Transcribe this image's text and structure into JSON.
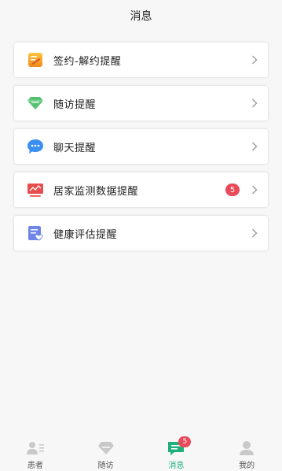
{
  "header": {
    "title": "消息"
  },
  "items": [
    {
      "label": "签约-解约提醒",
      "icon": "contract-icon"
    },
    {
      "label": "随访提醒",
      "icon": "diamond-icon"
    },
    {
      "label": "聊天提醒",
      "icon": "chat-bubble-icon"
    },
    {
      "label": "居家监测数据提醒",
      "icon": "monitor-chart-icon",
      "badge": "5"
    },
    {
      "label": "健康评估提醒",
      "icon": "health-assessment-icon"
    }
  ],
  "tabbar": {
    "tabs": [
      {
        "label": "患者",
        "icon": "patients-icon"
      },
      {
        "label": "随访",
        "icon": "follow-up-icon"
      },
      {
        "label": "消息",
        "icon": "message-icon",
        "badge": "5",
        "active": true
      },
      {
        "label": "我的",
        "icon": "profile-icon"
      }
    ]
  },
  "colors": {
    "accent": "#21b07a",
    "badge": "#e84a5a",
    "background": "#f7f7f7"
  }
}
